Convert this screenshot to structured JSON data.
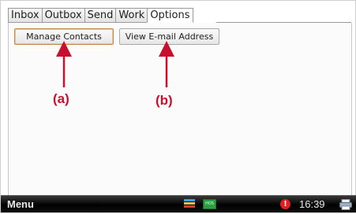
{
  "tabs": [
    {
      "label": "Inbox"
    },
    {
      "label": "Outbox"
    },
    {
      "label": "Send"
    },
    {
      "label": "Work"
    },
    {
      "label": "Options",
      "active": true
    }
  ],
  "buttons": {
    "manage_contacts": "Manage Contacts",
    "view_email": "View E-mail Address"
  },
  "callouts": {
    "a": "(a)",
    "b": "(b)"
  },
  "taskbar": {
    "menu_label": "Menu",
    "hos_label": "HOS",
    "alert_glyph": "!",
    "clock": "16:39"
  },
  "colors": {
    "callout_red": "#c8102e",
    "hos_green": "#2e9e44",
    "alert_red": "#e02020"
  },
  "icons": [
    "stack-icon",
    "hos-icon",
    "alert-icon",
    "printer-icon"
  ]
}
